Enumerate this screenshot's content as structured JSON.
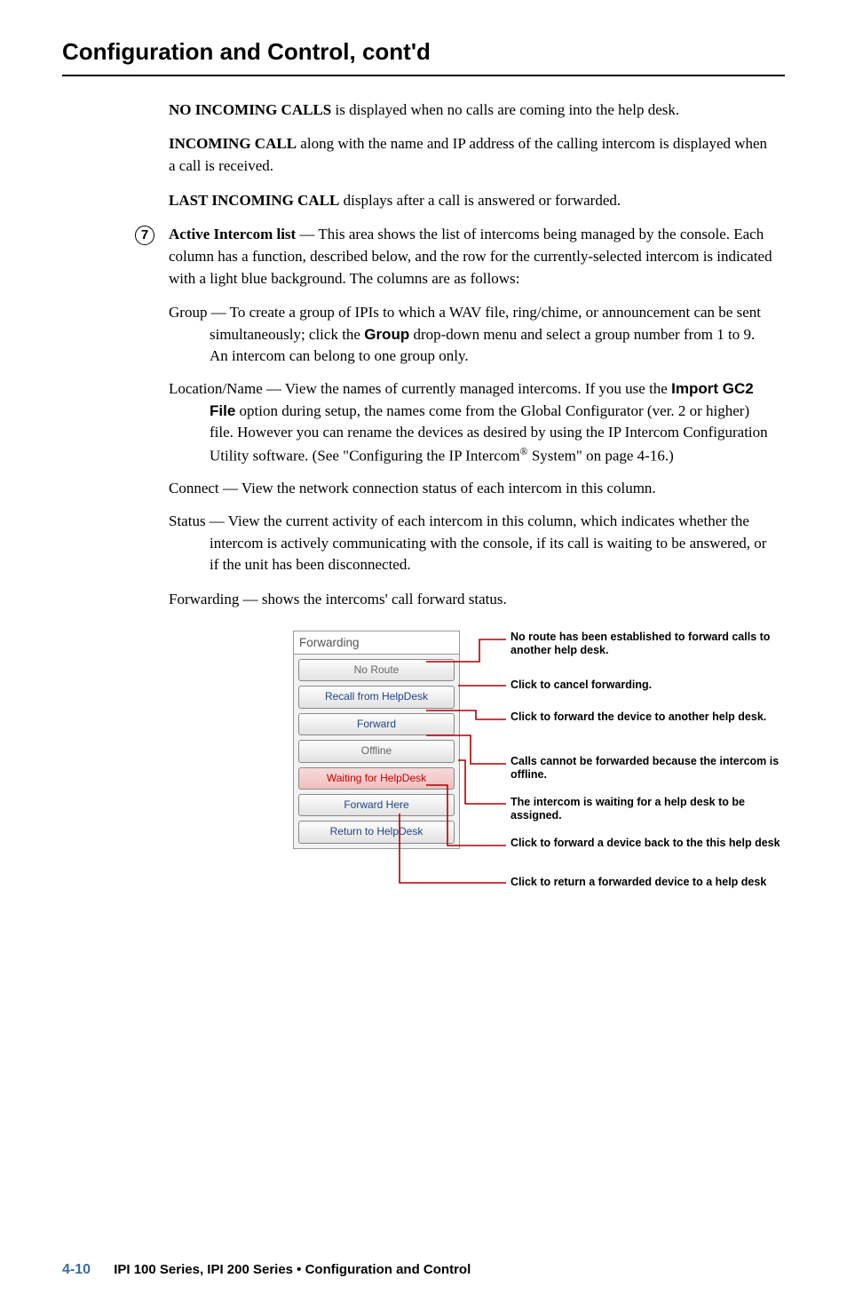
{
  "section_title": "Configuration and Control, cont'd",
  "p1a": "NO INCOMING CALLS",
  "p1b": " is displayed when no calls are coming into the help desk.",
  "p2a": "INCOMING CALL",
  "p2b": " along with the name and IP address of the calling intercom is displayed when a call is received.",
  "p3a": "LAST INCOMING CALL",
  "p3b": " displays after a call is answered or forwarded.",
  "item7_num": "7",
  "item7a": "Active Intercom list",
  "item7b": " — This area shows the list of intercoms being managed by the console.  Each column has a function, described below, and the row for the currently-selected intercom is indicated with a light blue background. The columns are as follows:",
  "sub_group_a": "Group — To create a group of IPIs to which a WAV file, ring/chime, or announcement can be sent simultaneously; click the ",
  "sub_group_btn": "Group",
  "sub_group_b": " drop-down menu and select a group number from 1 to 9.  An intercom can belong to one group only.",
  "sub_loc_a": "Location/Name — View the names of currently managed intercoms.  If you use the ",
  "sub_loc_btn": "Import GC2 File",
  "sub_loc_b": " option during setup, the names come from the Global Configurator (ver. 2 or higher) file.  However you can rename the devices as desired by using the IP Intercom Configuration Utility software.  (See \"Configuring the IP Intercom",
  "sub_loc_reg": "®",
  "sub_loc_c": " System\" on page 4-16.)",
  "sub_connect": "Connect — View the network connection status of each intercom in this column.",
  "sub_status": "Status — View the current activity of each intercom in this column, which indicates whether the intercom is actively communicating with the console, if its call is waiting to be answered, or if the unit has been disconnected.",
  "sub_fwd": "Forwarding — shows  the intercoms' call forward status.",
  "panel": {
    "header": "Forwarding",
    "no_route": "No Route",
    "recall": "Recall from HelpDesk",
    "forward": "Forward",
    "offline": "Offline",
    "waiting": "Waiting for HelpDesk",
    "fwd_here": "Forward Here",
    "return": "Return to HelpDesk"
  },
  "annot": {
    "no_route": "No route has been established to forward calls to another help desk.",
    "recall": "Click to cancel forwarding.",
    "forward": "Click to forward the device to another help desk.",
    "offline": "Calls cannot be forwarded because the intercom is offline.",
    "waiting": "The intercom is waiting for a help desk to be assigned.",
    "fwd_here": "Click to forward a device back to the this help desk",
    "return": "Click to return a forwarded device to a help desk"
  },
  "footer": {
    "page": "4-10",
    "title": "IPI 100 Series, IPI 200 Series • Configuration and Control"
  }
}
